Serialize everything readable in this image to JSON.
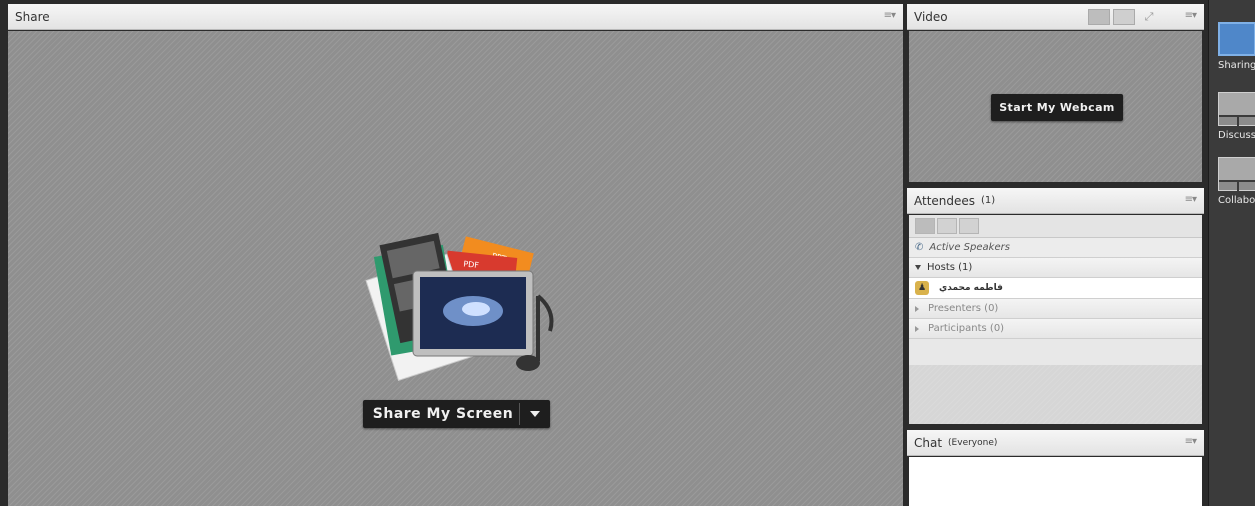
{
  "share_pod": {
    "title": "Share",
    "share_button_label": "Share My Screen",
    "art_labels": {
      "ppt": "PPT",
      "pdf": "PDF"
    }
  },
  "video_pod": {
    "title": "Video",
    "webcam_button_label": "Start My Webcam"
  },
  "attendees_pod": {
    "title": "Attendees",
    "count": "(1)",
    "active_speakers": "Active Speakers",
    "hosts_label": "Hosts (1)",
    "host_user": "فاطمه محمدي",
    "presenters_label": "Presenters (0)",
    "participants_label": "Participants (0)"
  },
  "chat_pod": {
    "title": "Chat",
    "scope": "(Everyone)"
  },
  "layouts": [
    {
      "label": "Sharing",
      "selected": true
    },
    {
      "label": "Discuss",
      "selected": false
    },
    {
      "label": "Collabo",
      "selected": false
    }
  ],
  "icons": {
    "pod_menu": "pod-menu-icon",
    "phone": "phone-icon",
    "host_badge": "host-badge-icon"
  }
}
